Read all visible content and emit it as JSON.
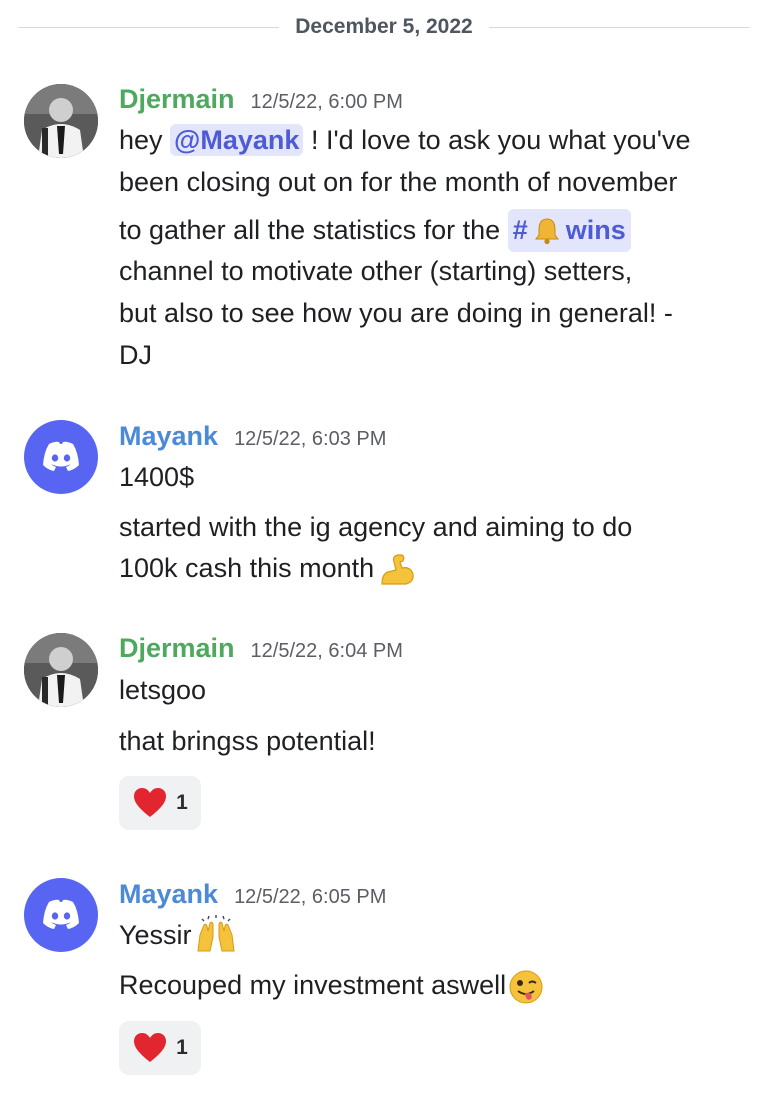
{
  "divider": {
    "date": "December 5, 2022"
  },
  "messages": [
    {
      "author": "Djermain",
      "time": "12/5/22, 6:00 PM",
      "lines": {
        "l1_pre": "hey ",
        "l1_mention": "@Mayank",
        "l1_post": " ! I'd love to ask you what you've",
        "l2": "been closing out on for the month of november",
        "l3_pre": "to gather all the statistics for the ",
        "l3_channel_hash": "#",
        "l3_channel_name": "wins",
        "l4": "channel to motivate other (starting) setters,",
        "l5": "but also to see how you are doing in general! -",
        "l6": "DJ"
      }
    },
    {
      "author": "Mayank",
      "time": "12/5/22, 6:03 PM",
      "lines": {
        "l1": "1400$",
        "l2": "started with the ig agency  and aiming to do",
        "l3": "100k cash this month"
      }
    },
    {
      "author": "Djermain",
      "time": "12/5/22, 6:04 PM",
      "lines": {
        "l1": "letsgoo",
        "l2": "that bringss potential!"
      },
      "reaction": {
        "emoji": "heart",
        "count": "1"
      }
    },
    {
      "author": "Mayank",
      "time": "12/5/22, 6:05 PM",
      "lines": {
        "l1": "Yessir",
        "l2": "Recouped my investment aswell"
      },
      "reaction": {
        "emoji": "heart",
        "count": "1"
      }
    }
  ],
  "icons": {
    "bell": "bell-icon",
    "muscle": "flexed-biceps-emoji",
    "raised_hands": "raised-hands-emoji",
    "wink_tongue": "winking-tongue-emoji",
    "heart": "red-heart-emoji",
    "discord": "discord-logo-icon"
  },
  "colors": {
    "djermain_name": "#4ea85e",
    "mayank_name": "#4d8ad6",
    "mention_bg": "#e3e6fb",
    "mention_fg": "#4e5bd6",
    "discord_blurple": "#5865f2",
    "reaction_bg": "#f0f1f3"
  }
}
